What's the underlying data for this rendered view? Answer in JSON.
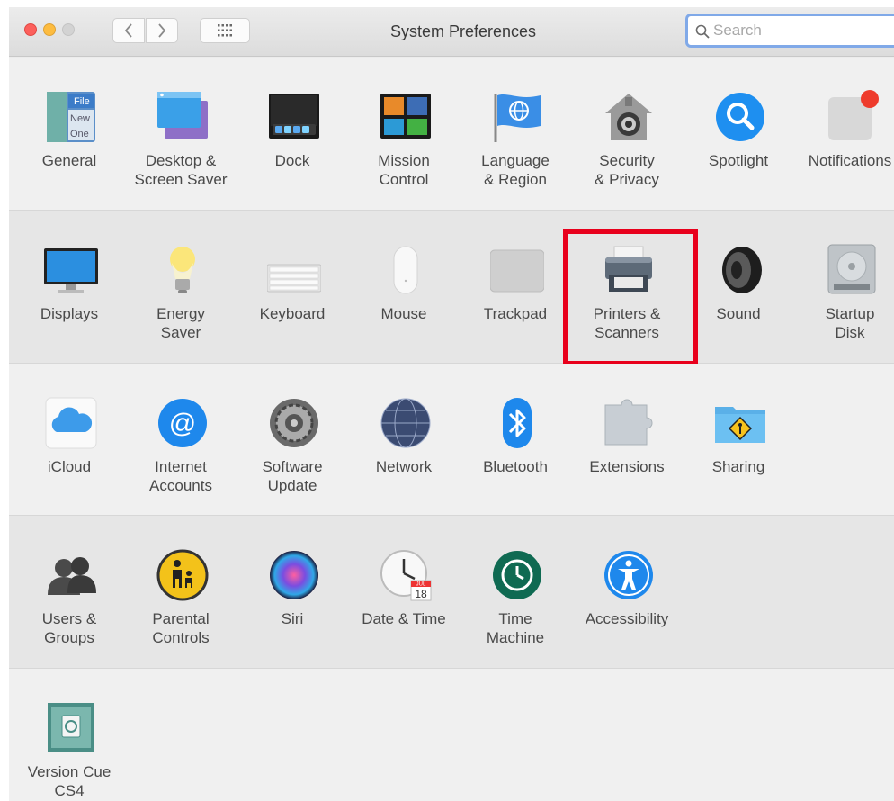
{
  "window": {
    "title": "System Preferences"
  },
  "search": {
    "placeholder": "Search",
    "value": ""
  },
  "rows": [
    {
      "items": [
        {
          "label": "General",
          "icon": "general-icon"
        },
        {
          "label": "Desktop &\nScreen Saver",
          "icon": "desktop-screensaver-icon"
        },
        {
          "label": "Dock",
          "icon": "dock-icon"
        },
        {
          "label": "Mission\nControl",
          "icon": "mission-control-icon"
        },
        {
          "label": "Language\n& Region",
          "icon": "language-region-icon"
        },
        {
          "label": "Security\n& Privacy",
          "icon": "security-privacy-icon"
        },
        {
          "label": "Spotlight",
          "icon": "spotlight-icon"
        },
        {
          "label": "Notifications",
          "icon": "notifications-icon"
        }
      ]
    },
    {
      "items": [
        {
          "label": "Displays",
          "icon": "displays-icon"
        },
        {
          "label": "Energy\nSaver",
          "icon": "energy-saver-icon"
        },
        {
          "label": "Keyboard",
          "icon": "keyboard-icon"
        },
        {
          "label": "Mouse",
          "icon": "mouse-icon"
        },
        {
          "label": "Trackpad",
          "icon": "trackpad-icon"
        },
        {
          "label": "Printers &\nScanners",
          "icon": "printers-scanners-icon"
        },
        {
          "label": "Sound",
          "icon": "sound-icon"
        },
        {
          "label": "Startup\nDisk",
          "icon": "startup-disk-icon"
        }
      ]
    },
    {
      "items": [
        {
          "label": "iCloud",
          "icon": "icloud-icon"
        },
        {
          "label": "Internet\nAccounts",
          "icon": "internet-accounts-icon"
        },
        {
          "label": "Software\nUpdate",
          "icon": "software-update-icon"
        },
        {
          "label": "Network",
          "icon": "network-icon"
        },
        {
          "label": "Bluetooth",
          "icon": "bluetooth-icon"
        },
        {
          "label": "Extensions",
          "icon": "extensions-icon"
        },
        {
          "label": "Sharing",
          "icon": "sharing-icon"
        }
      ]
    },
    {
      "items": [
        {
          "label": "Users &\nGroups",
          "icon": "users-groups-icon"
        },
        {
          "label": "Parental\nControls",
          "icon": "parental-controls-icon"
        },
        {
          "label": "Siri",
          "icon": "siri-icon"
        },
        {
          "label": "Date & Time",
          "icon": "date-time-icon"
        },
        {
          "label": "Time\nMachine",
          "icon": "time-machine-icon"
        },
        {
          "label": "Accessibility",
          "icon": "accessibility-icon"
        }
      ]
    },
    {
      "items": [
        {
          "label": "Version Cue\nCS4",
          "icon": "version-cue-icon"
        }
      ]
    }
  ],
  "icon_text": {
    "general": [
      "File",
      "New",
      "One"
    ],
    "calendar_month": "JUL",
    "calendar_day": "18"
  },
  "colors": {
    "highlight": "#e8001c",
    "search_focus": "#80a9e8"
  },
  "highlighted_item": "Printers &\nScanners"
}
